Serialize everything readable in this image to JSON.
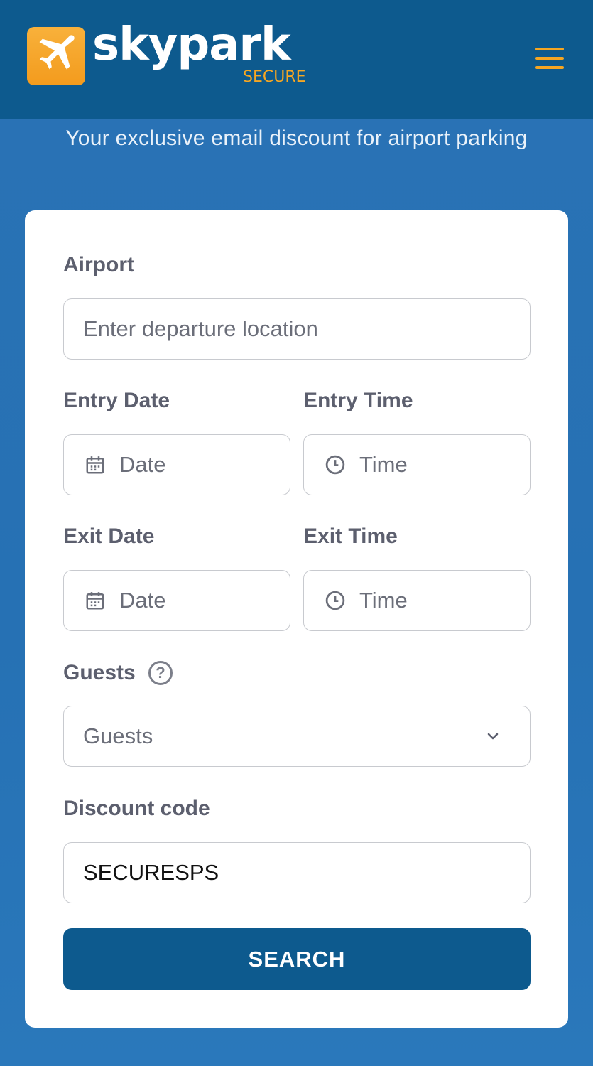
{
  "header": {
    "brand_name": "skypark",
    "brand_sub": "SECURE",
    "logo_icon": "airplane-icon",
    "menu_icon": "hamburger-menu-icon",
    "colors": {
      "header_bg": "#0d5a8e",
      "accent": "#f5a623",
      "page_bg": "#2671b4"
    }
  },
  "tagline": "Your exclusive email discount for airport parking",
  "form": {
    "airport": {
      "label": "Airport",
      "placeholder": "Enter departure location"
    },
    "entry_date": {
      "label": "Entry Date",
      "placeholder": "Date",
      "icon": "calendar-icon"
    },
    "entry_time": {
      "label": "Entry Time",
      "placeholder": "Time",
      "icon": "clock-icon"
    },
    "exit_date": {
      "label": "Exit Date",
      "placeholder": "Date",
      "icon": "calendar-icon"
    },
    "exit_time": {
      "label": "Exit Time",
      "placeholder": "Time",
      "icon": "clock-icon"
    },
    "guests": {
      "label": "Guests",
      "help_glyph": "?",
      "selected": "Guests",
      "icon": "chevron-down-icon"
    },
    "discount": {
      "label": "Discount code",
      "value": "SECURESPS"
    },
    "search_label": "SEARCH"
  }
}
